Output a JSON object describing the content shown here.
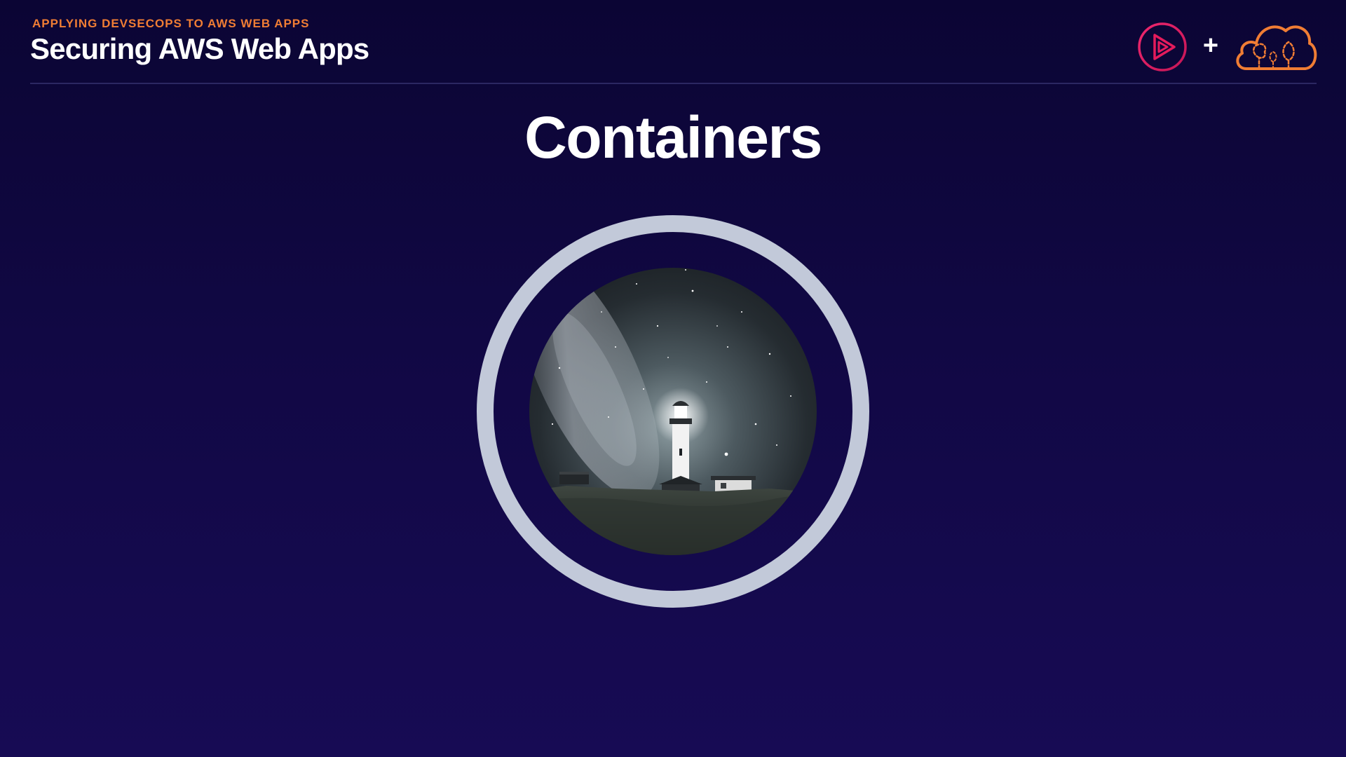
{
  "header": {
    "eyebrow": "APPLYING DEVSECOPS TO AWS WEB APPS",
    "course_title": "Securing AWS Web Apps",
    "plus_sign": "+",
    "logos": [
      {
        "name": "pluralsight-play-icon",
        "color": "#e41b5c"
      },
      {
        "name": "cloud-trees-icon",
        "color": "#f07d34"
      }
    ]
  },
  "slide": {
    "title": "Containers",
    "illustration": {
      "subject": "lighthouse-night-sky-photo",
      "ring_color": "#c2c9d9"
    }
  },
  "colors": {
    "background_top": "#0b0534",
    "background_bottom": "#170b54",
    "accent_orange": "#f07d34",
    "divider": "#2b2762",
    "text": "#ffffff"
  }
}
